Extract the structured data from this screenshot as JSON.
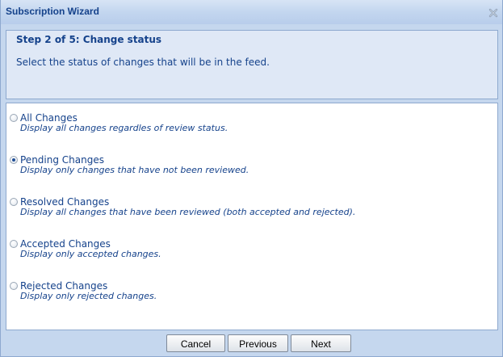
{
  "window": {
    "title": "Subscription Wizard",
    "close_icon": "close-x-icon"
  },
  "header": {
    "step_title": "Step 2 of 5: Change status",
    "description": "Select the status of changes that will be in the feed."
  },
  "options": [
    {
      "label": "All Changes",
      "description": "Display all changes regardles of review status.",
      "checked": false
    },
    {
      "label": "Pending Changes",
      "description": "Display only changes that have not been reviewed.",
      "checked": true
    },
    {
      "label": "Resolved Changes",
      "description": "Display all changes that have been reviewed (both accepted and rejected).",
      "checked": false
    },
    {
      "label": "Accepted Changes",
      "description": "Display only accepted changes.",
      "checked": false
    },
    {
      "label": "Rejected Changes",
      "description": "Display only rejected changes.",
      "checked": false
    }
  ],
  "buttons": {
    "cancel": "Cancel",
    "previous": "Previous",
    "next": "Next"
  },
  "colors": {
    "title_text": "#15428b",
    "frame": "#c5d7ee",
    "header_bg": "#dfe8f6",
    "border": "#8ea9cf"
  }
}
